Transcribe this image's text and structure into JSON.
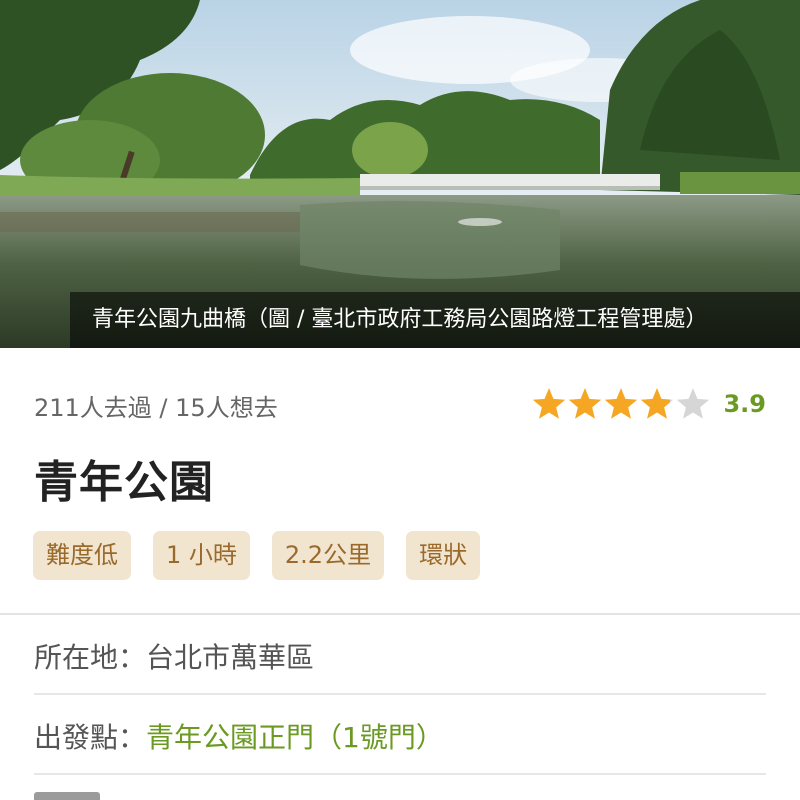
{
  "hero": {
    "caption": "青年公園九曲橋（圖 / 臺北市政府工務局公園路燈工程管理處）"
  },
  "stats": {
    "visited": "211人去過 / 15人想去"
  },
  "rating": {
    "score": "3.9",
    "value": 3.9,
    "max": 5,
    "star_color": "#f5a623",
    "empty_color": "#d6d6d6"
  },
  "trail": {
    "name": "青年公園"
  },
  "tags": [
    "難度低",
    "1 小時",
    "2.2公里",
    "環狀"
  ],
  "details": {
    "location_label": "所在地：",
    "location_value": "台北市萬華區",
    "start_label": "出發點：",
    "start_value": "青年公園正門（1號門）"
  },
  "colors": {
    "accent_green": "#6a9a22",
    "tag_bg": "#f2e5d0",
    "tag_text": "#9a6a2c"
  }
}
